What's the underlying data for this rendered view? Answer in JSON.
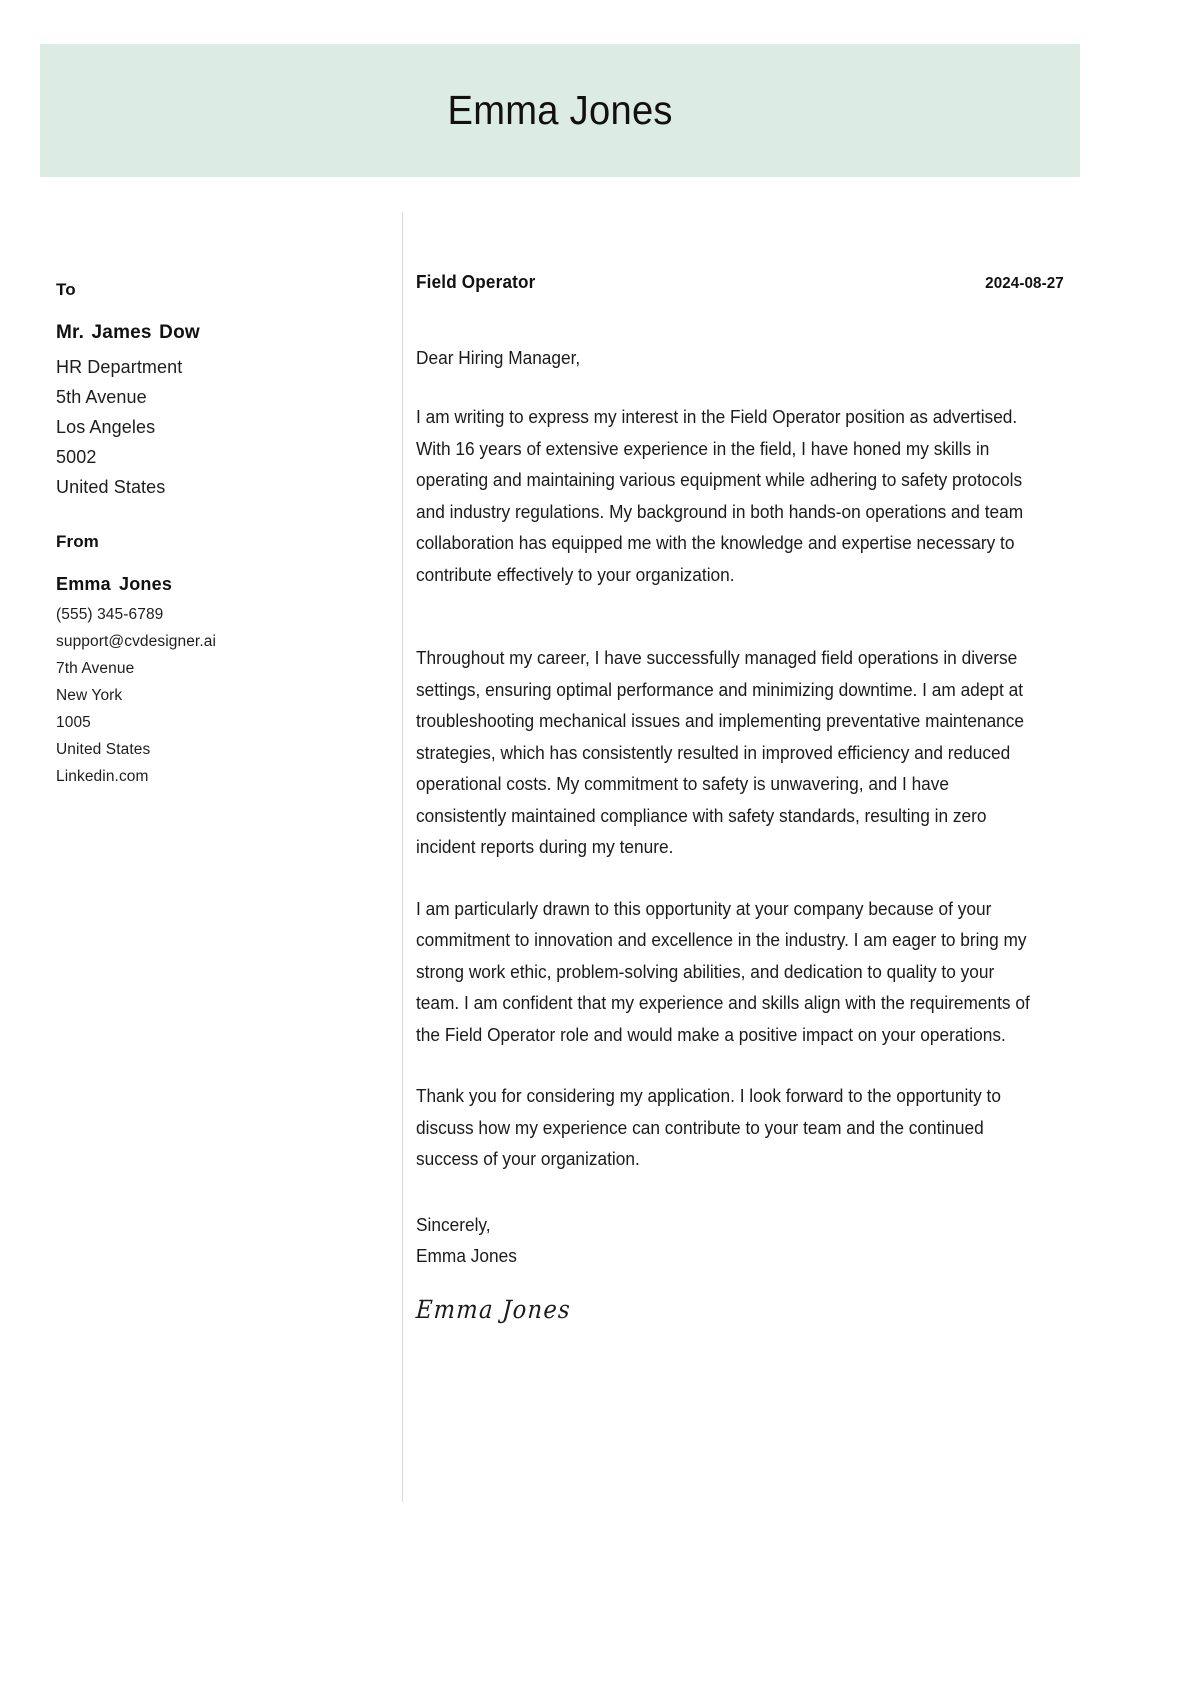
{
  "document": {
    "type": "cover-letter",
    "accent_color": "#dcebe4",
    "text_color": "#1b1b1b",
    "divider_color": "#d3dedb"
  },
  "header": {
    "name": "Emma Jones"
  },
  "sidebar": {
    "to": {
      "heading": "To",
      "name": "Mr. James Dow",
      "lines": [
        "HR Department",
        "5th Avenue",
        "Los Angeles",
        "5002",
        "United States"
      ]
    },
    "from": {
      "heading": "From",
      "name": "Emma Jones",
      "lines": [
        "(555) 345-6789",
        "support@cvdesigner.ai",
        "7th Avenue",
        "New York",
        "1005",
        "United States",
        "Linkedin.com"
      ]
    }
  },
  "letter": {
    "job_title": "Field Operator",
    "date": "2024-08-27",
    "salutation": "Dear Hiring Manager,",
    "paragraphs": [
      "I am writing to express my interest in the Field Operator position as advertised. With 16 years of extensive experience in the field, I have honed my skills in operating and maintaining various equipment while adhering to safety protocols and industry regulations. My background in both hands-on operations and team collaboration has equipped me with the knowledge and expertise necessary to contribute effectively to your organization.",
      "Throughout my career, I have successfully managed field operations in diverse settings, ensuring optimal performance and minimizing downtime. I am adept at troubleshooting mechanical issues and implementing preventative maintenance strategies, which has consistently resulted in improved efficiency and reduced operational costs. My commitment to safety is unwavering, and I have consistently maintained compliance with safety standards, resulting in zero incident reports during my tenure.",
      "I am particularly drawn to this opportunity at your company because of your commitment to innovation and excellence in the industry. I am eager to bring my strong work ethic, problem-solving abilities, and dedication to quality to your team. I am confident that my experience and skills align with the requirements of the Field Operator role and would make a positive impact on your operations.",
      "Thank you for considering my application. I look forward to the opportunity to discuss how my experience can contribute to your team and the continued success of your organization."
    ],
    "closing_phrase": "Sincerely,",
    "closing_name": "Emma Jones",
    "signature": "Emma Jones"
  }
}
